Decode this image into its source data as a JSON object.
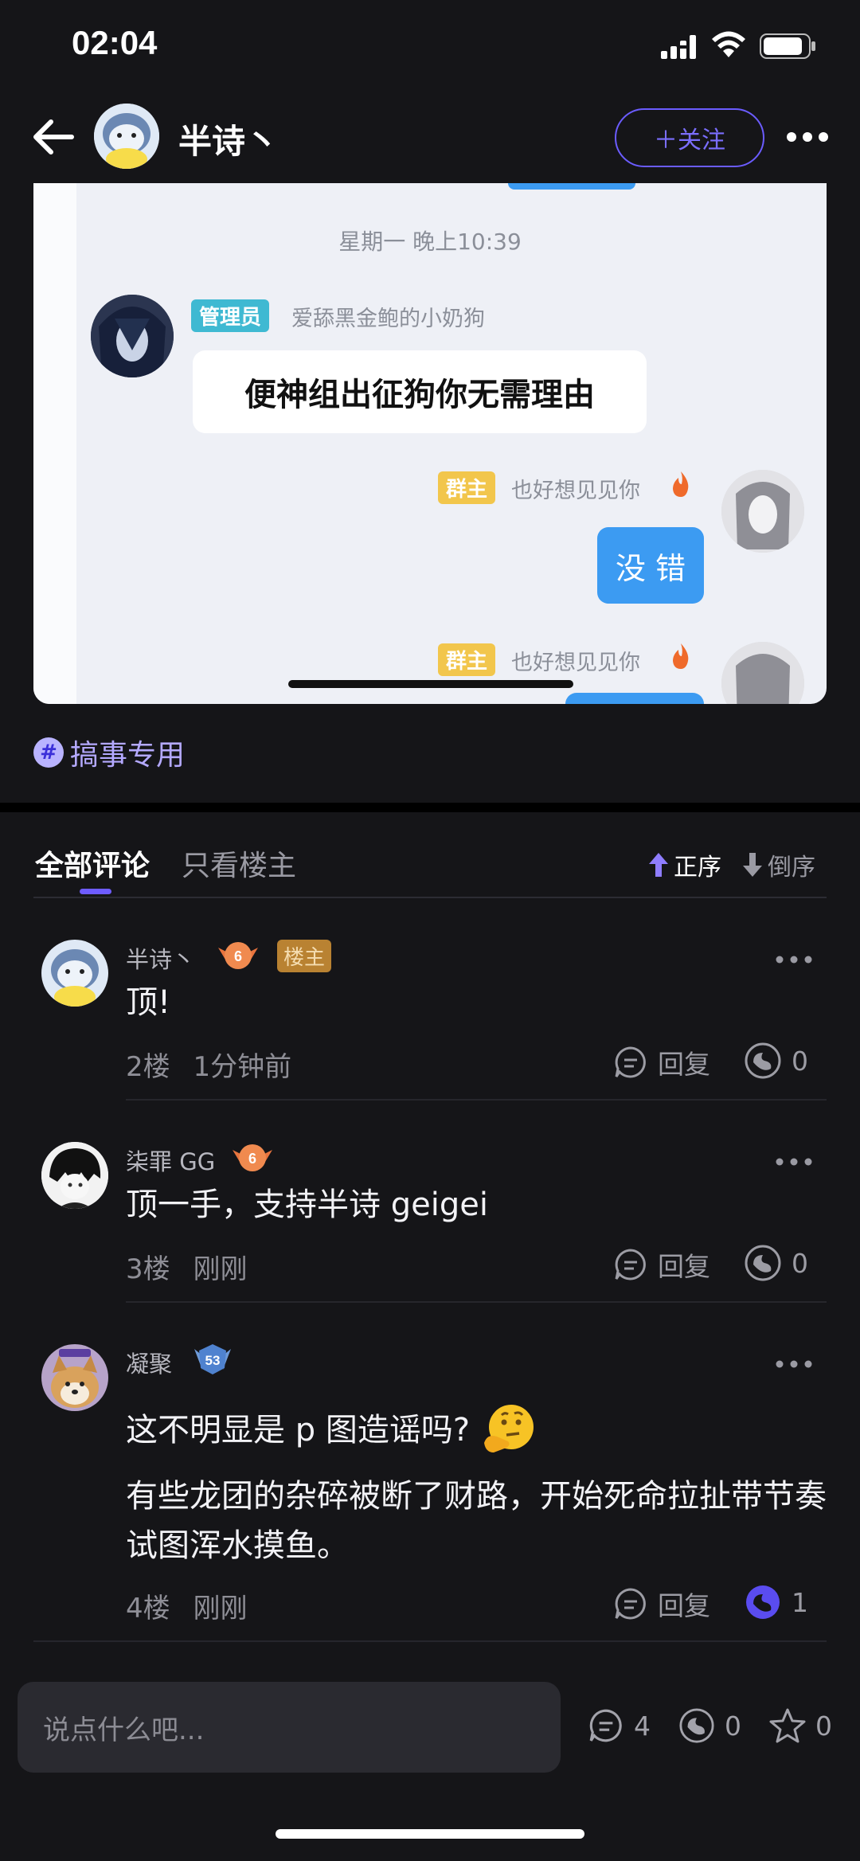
{
  "status_bar": {
    "time": "02:04"
  },
  "nav": {
    "author_name": "半诗丶",
    "follow_label": "＋关注"
  },
  "post_image": {
    "date_label": "星期一 晚上10:39",
    "msg1": {
      "badge": "管理员",
      "sender": "爱舔黑金鲍的小奶狗",
      "text": "便神组出征狗你无需理由"
    },
    "msg2": {
      "badge": "群主",
      "sender": "也好想见见你",
      "text": "没 错"
    },
    "msg3": {
      "badge": "群主",
      "sender": "也好想见见你"
    }
  },
  "topic": {
    "label": "搞事专用"
  },
  "comment_tabs": {
    "tabs": [
      "全部评论",
      "只看楼主"
    ],
    "sort_asc": "正序",
    "sort_desc": "倒序"
  },
  "comments": [
    {
      "name": "半诗丶",
      "level": "6",
      "owner_tag": "楼主",
      "text": "顶!",
      "floor": "2楼",
      "time": "1分钟前",
      "reply_label": "回复",
      "likes": "0"
    },
    {
      "name": "柒罪 GG",
      "level": "6",
      "text": "顶一手，支持半诗 geigei",
      "floor": "3楼",
      "time": "刚刚",
      "reply_label": "回复",
      "likes": "0"
    },
    {
      "name": "凝聚",
      "level": "53",
      "text_line1": "这不明显是 p 图造谣吗?",
      "text_line2": "有些龙团的杂碎被断了财路，开始死命拉扯带节奏试图浑水摸鱼。",
      "floor": "4楼",
      "time": "刚刚",
      "reply_label": "回复",
      "likes": "1"
    }
  ],
  "bottom_bar": {
    "placeholder": "说点什么吧...",
    "comment_count": "4",
    "like_count": "0",
    "star_count": "0"
  },
  "colors": {
    "accent": "#6e5cff",
    "background": "#151518",
    "owner_tag": "#b98232",
    "topic": "#b4a9ff"
  }
}
